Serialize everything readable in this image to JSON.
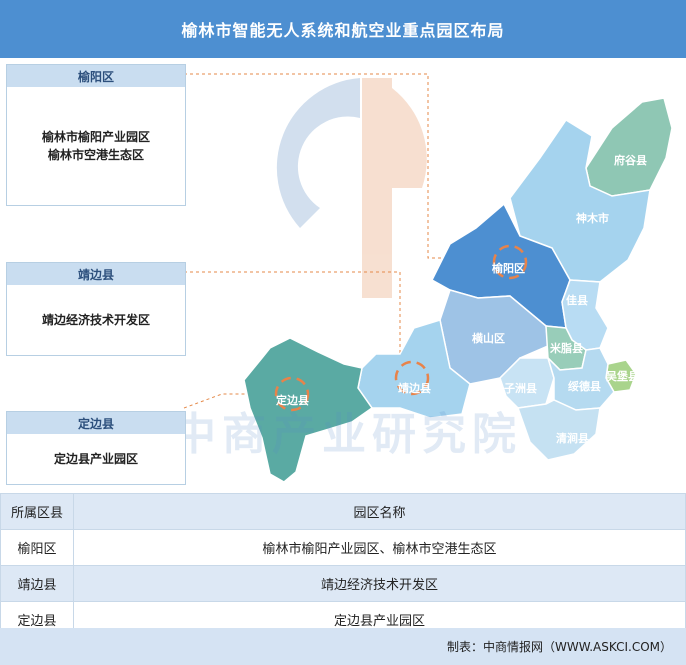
{
  "title": "榆林市智能无人系统和航空业重点园区布局",
  "cards": [
    {
      "header": "榆阳区",
      "lines": [
        "榆林市榆阳产业园区",
        "榆林市空港生态区"
      ]
    },
    {
      "header": "靖边县",
      "lines": [
        "靖边经济技术开发区"
      ]
    },
    {
      "header": "定边县",
      "lines": [
        "定边县产业园区"
      ]
    }
  ],
  "map_regions": [
    {
      "name": "府谷县",
      "color": "#8fc7b4"
    },
    {
      "name": "神木市",
      "color": "#a5d3ee"
    },
    {
      "name": "榆阳区",
      "color": "#4d8fd1"
    },
    {
      "name": "佳县",
      "color": "#b8dcf3"
    },
    {
      "name": "横山区",
      "color": "#9ec3e6"
    },
    {
      "name": "米脂县",
      "color": "#98cdb9"
    },
    {
      "name": "吴堡县",
      "color": "#a9d48c"
    },
    {
      "name": "靖边县",
      "color": "#a5d3ee"
    },
    {
      "name": "子洲县",
      "color": "#c8e3f4"
    },
    {
      "name": "绥德县",
      "color": "#b5daf0"
    },
    {
      "name": "清涧县",
      "color": "#c5e1f2"
    },
    {
      "name": "定边县",
      "color": "#5aaaa3"
    }
  ],
  "watermark": "中商产业研究院",
  "table": {
    "headers": [
      "所属区县",
      "园区名称"
    ],
    "rows": [
      {
        "county": "榆阳区",
        "parks": "榆林市榆阳产业园区、榆林市空港生态区"
      },
      {
        "county": "靖边县",
        "parks": "靖边经济技术开发区"
      },
      {
        "county": "定边县",
        "parks": "定边县产业园区"
      }
    ]
  },
  "footer": "制表：中商情报网（WWW.ASKCI.COM）"
}
